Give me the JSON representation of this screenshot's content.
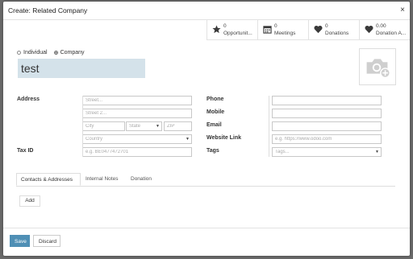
{
  "dialog": {
    "title": "Create: Related Company",
    "close_glyph": "×"
  },
  "smart_buttons": [
    {
      "count": "0",
      "label": "Opportunit...",
      "icon": "star-icon"
    },
    {
      "count": "0",
      "label": "Meetings",
      "icon": "calendar-icon"
    },
    {
      "count": "0",
      "label": "Donations",
      "icon": "heart-icon"
    },
    {
      "count": "0.00",
      "label": "Donation A...",
      "icon": "heart-icon"
    }
  ],
  "company_type": {
    "options": [
      "Individual",
      "Company"
    ],
    "selected": "Company"
  },
  "name": {
    "value": "test"
  },
  "address": {
    "label": "Address",
    "street_placeholder": "Street...",
    "street2_placeholder": "Street 2...",
    "city_placeholder": "City",
    "state_placeholder": "State",
    "zip_placeholder": "ZIP",
    "country_placeholder": "Country"
  },
  "tax_id": {
    "label": "Tax ID",
    "placeholder": "e.g. BE0477472701"
  },
  "contact": {
    "phone_label": "Phone",
    "mobile_label": "Mobile",
    "email_label": "Email",
    "website_label": "Website Link",
    "website_placeholder": "e.g. https://www.odoo.com",
    "tags_label": "Tags",
    "tags_placeholder": "Tags..."
  },
  "tabs": [
    {
      "label": "Contacts & Addresses",
      "active": true
    },
    {
      "label": "Internal Notes",
      "active": false
    },
    {
      "label": "Donation",
      "active": false
    }
  ],
  "add_label": "Add",
  "footer": {
    "save_label": "Save",
    "discard_label": "Discard"
  },
  "colors": {
    "primary": "#4f8fb5",
    "name_bg": "#d4e2ea",
    "overlay": "#6b6b6b"
  }
}
